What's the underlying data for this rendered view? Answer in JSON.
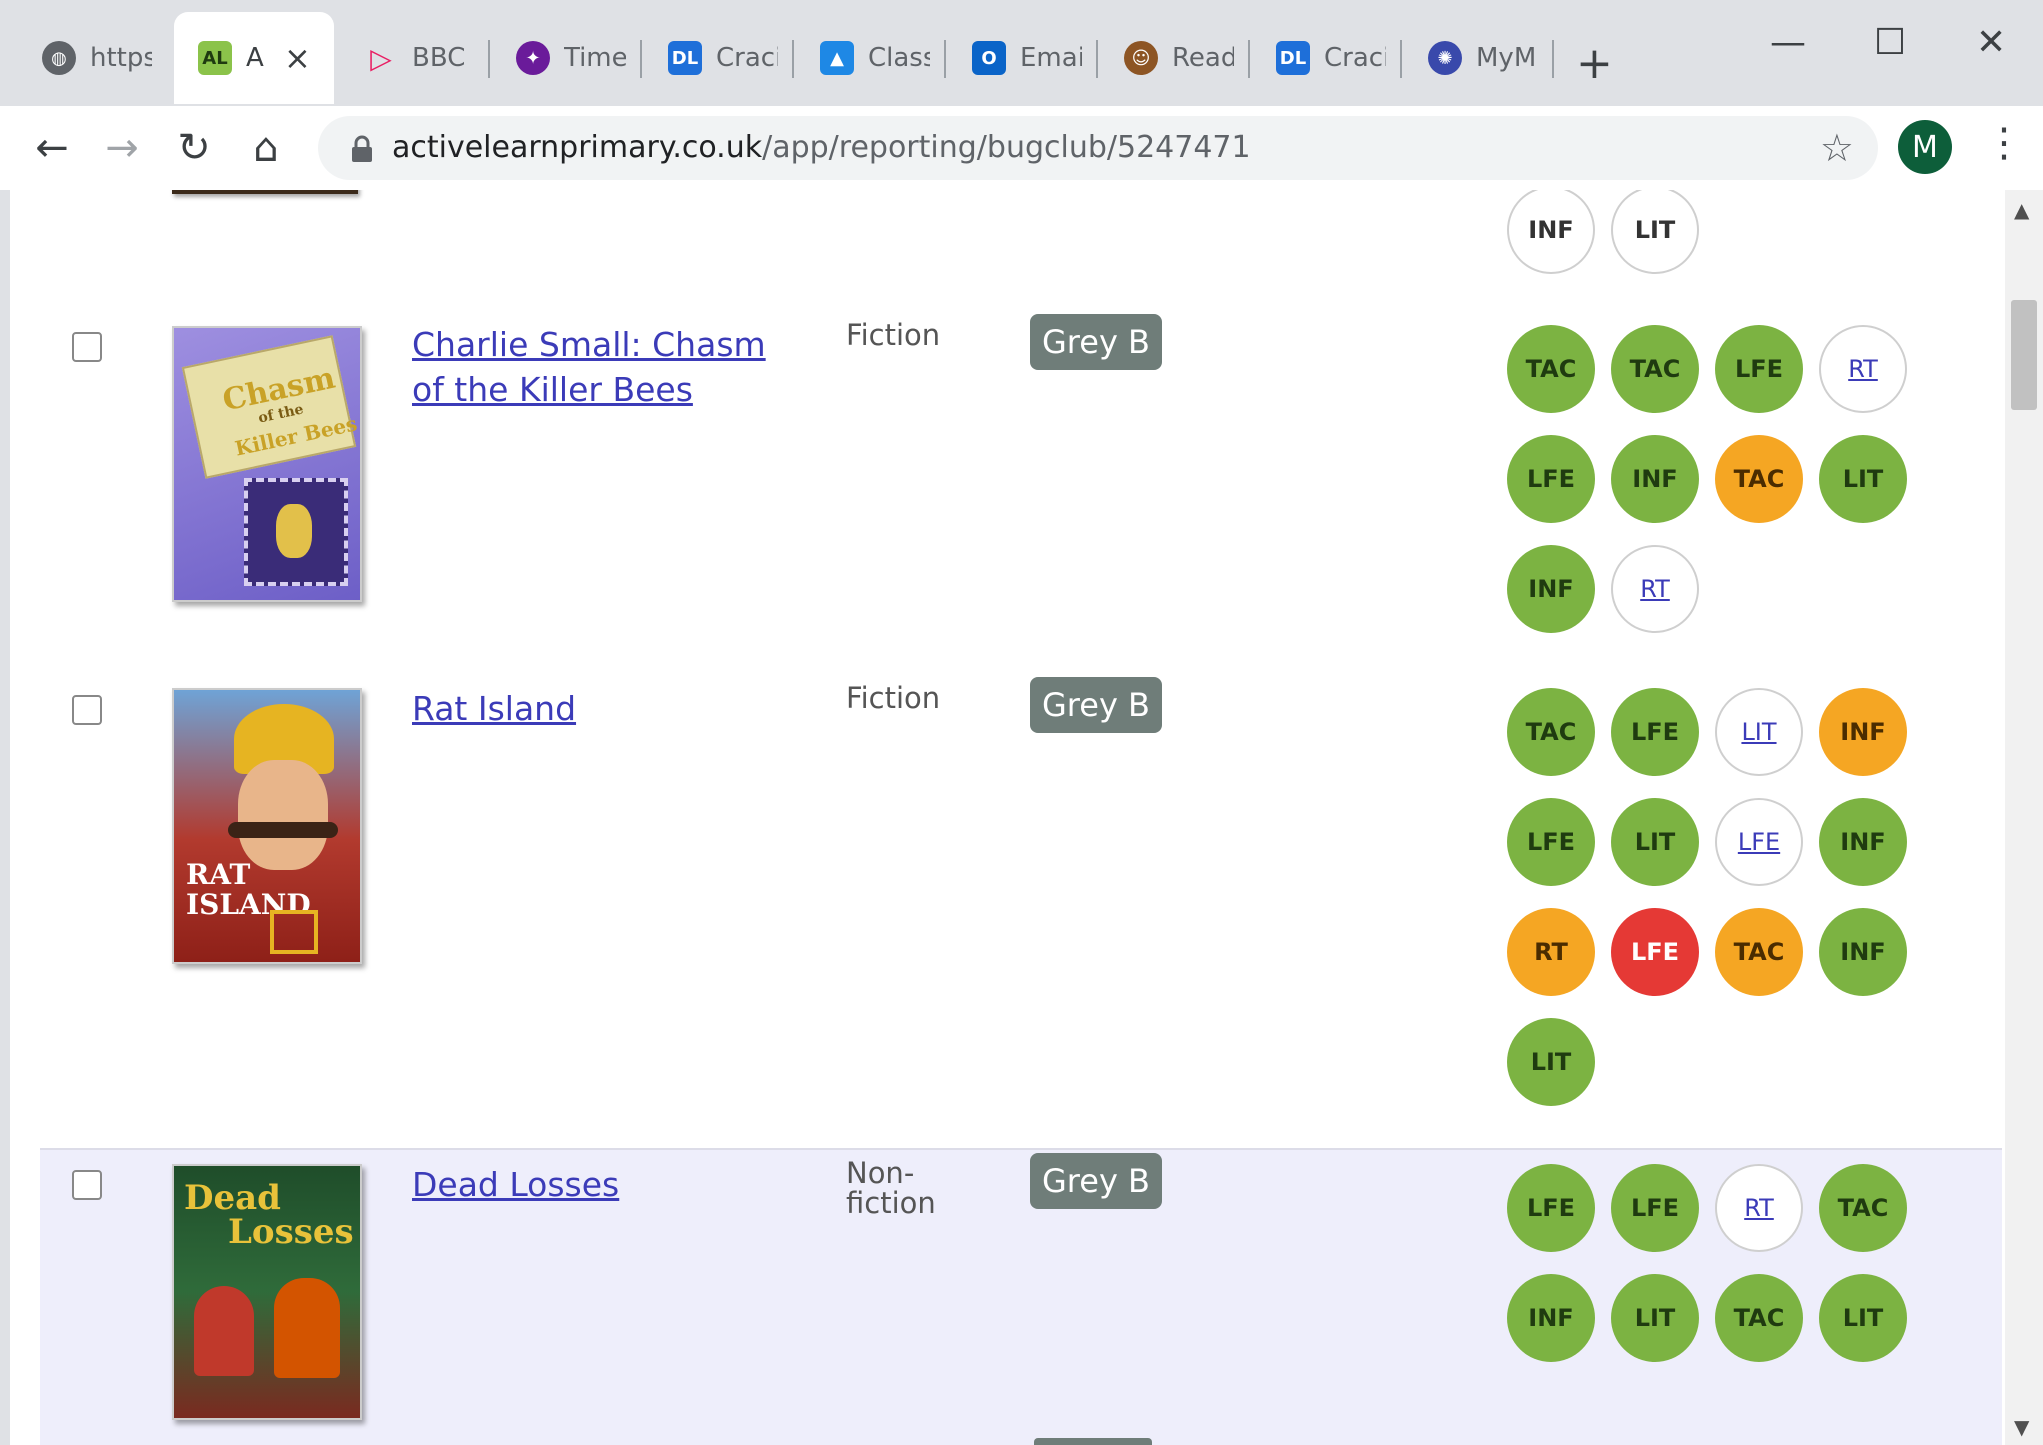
{
  "browser": {
    "tabs": [
      {
        "title": "https:",
        "icon": "globe-icon"
      },
      {
        "title": "A",
        "icon": "al-logo-icon",
        "active": true
      },
      {
        "title": "BBC",
        "icon": "play-icon"
      },
      {
        "title": "Time",
        "icon": "bird-icon"
      },
      {
        "title": "Craci",
        "icon": "dl-logo-icon"
      },
      {
        "title": "Class",
        "icon": "classroom-icon"
      },
      {
        "title": "Emai",
        "icon": "outlook-icon"
      },
      {
        "title": "Read",
        "icon": "reader-icon"
      },
      {
        "title": "Craci",
        "icon": "dl-logo-icon"
      },
      {
        "title": "MyM",
        "icon": "mym-icon"
      }
    ],
    "url_host": "activelearnprimary.co.uk",
    "url_path": "/app/reporting/bugclub/5247471",
    "profile_initial": "M"
  },
  "colors": {
    "green": "#7cb342",
    "orange": "#f5a623",
    "red": "#e53935",
    "badge": "#6f7d79",
    "link": "#3b3bb8",
    "highlight_row": "#eeeefb"
  },
  "previous_row": {
    "circles": [
      {
        "label": "INF",
        "style": "white"
      },
      {
        "label": "LIT",
        "style": "white"
      }
    ]
  },
  "books": [
    {
      "title_line1": "Charlie Small: Chasm",
      "title_line2": "of the Killer Bees",
      "genre_line1": "Fiction",
      "genre_line2": "",
      "level": "Grey B",
      "cover_text_1": "Chasm",
      "cover_text_2": "of the",
      "cover_text_3": "Killer Bees",
      "circles": [
        {
          "label": "TAC",
          "style": "green"
        },
        {
          "label": "TAC",
          "style": "green"
        },
        {
          "label": "LFE",
          "style": "green"
        },
        {
          "label": "RT",
          "style": "white-link"
        },
        {
          "label": "LFE",
          "style": "green"
        },
        {
          "label": "INF",
          "style": "green"
        },
        {
          "label": "TAC",
          "style": "orange"
        },
        {
          "label": "LIT",
          "style": "green"
        },
        {
          "label": "INF",
          "style": "green"
        },
        {
          "label": "RT",
          "style": "white-link"
        }
      ]
    },
    {
      "title_line1": "Rat Island",
      "title_line2": "",
      "genre_line1": "Fiction",
      "genre_line2": "",
      "level": "Grey B",
      "cover_text_1": "RAT",
      "cover_text_2": "ISLAND",
      "cover_text_3": "",
      "circles": [
        {
          "label": "TAC",
          "style": "green"
        },
        {
          "label": "LFE",
          "style": "green"
        },
        {
          "label": "LIT",
          "style": "white-link"
        },
        {
          "label": "INF",
          "style": "orange"
        },
        {
          "label": "LFE",
          "style": "green"
        },
        {
          "label": "LIT",
          "style": "green"
        },
        {
          "label": "LFE",
          "style": "white-link"
        },
        {
          "label": "INF",
          "style": "green"
        },
        {
          "label": "RT",
          "style": "orange"
        },
        {
          "label": "LFE",
          "style": "red"
        },
        {
          "label": "TAC",
          "style": "orange"
        },
        {
          "label": "INF",
          "style": "green"
        },
        {
          "label": "LIT",
          "style": "green"
        }
      ]
    },
    {
      "title_line1": "Dead Losses",
      "title_line2": "",
      "genre_line1": "Non-",
      "genre_line2": "fiction",
      "level": "Grey B",
      "cover_text_1": "Dead",
      "cover_text_2": "Losses",
      "cover_text_3": "",
      "circles": [
        {
          "label": "LFE",
          "style": "green"
        },
        {
          "label": "LFE",
          "style": "green"
        },
        {
          "label": "RT",
          "style": "white-link"
        },
        {
          "label": "TAC",
          "style": "green"
        },
        {
          "label": "INF",
          "style": "green"
        },
        {
          "label": "LIT",
          "style": "green"
        },
        {
          "label": "TAC",
          "style": "green"
        },
        {
          "label": "LIT",
          "style": "green"
        }
      ]
    }
  ]
}
